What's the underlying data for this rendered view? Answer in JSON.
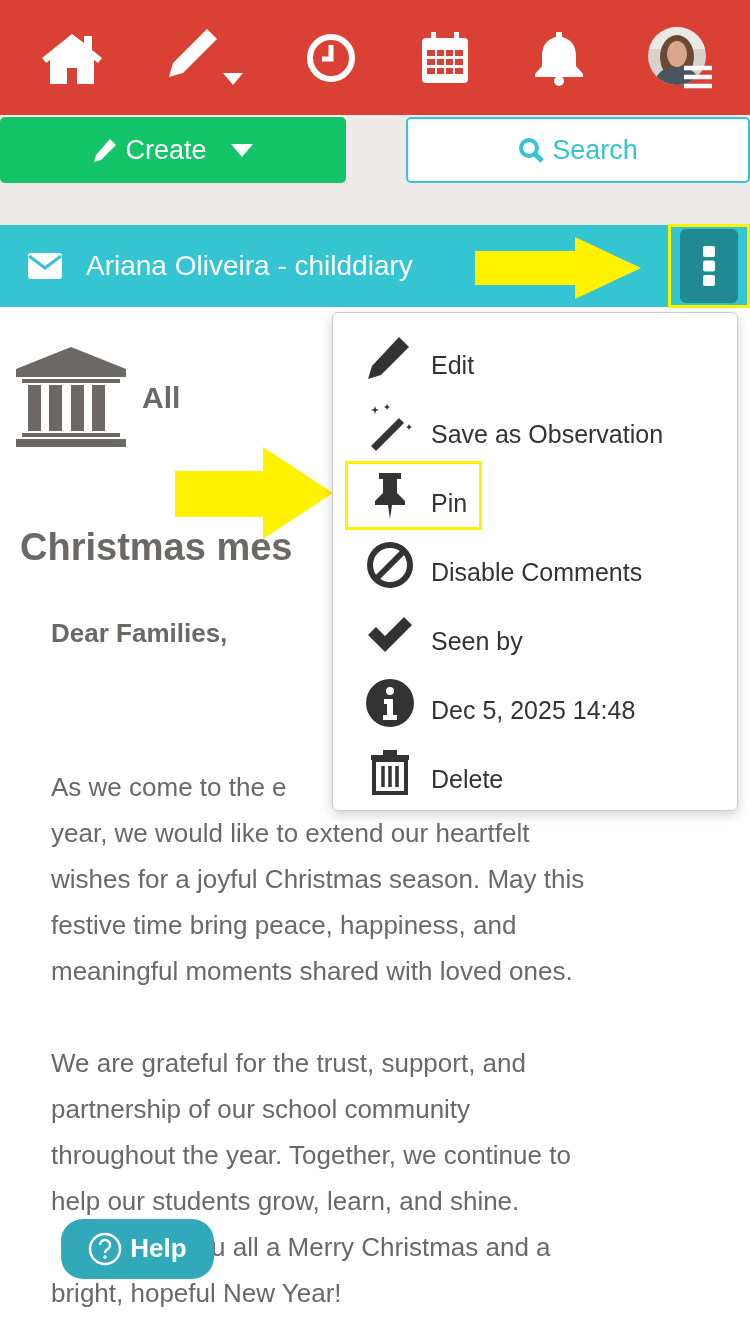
{
  "toolbar": {
    "create_button": "Create",
    "search_button": "Search"
  },
  "post_header": {
    "title": "Ariana Oliveira - childdiary",
    "menu_highlighted": true
  },
  "menu": {
    "items": [
      {
        "kind": "edit",
        "label": "Edit",
        "highlighted": false
      },
      {
        "kind": "observation",
        "label": "Save as Observation",
        "highlighted": false
      },
      {
        "kind": "pin",
        "label": "Pin",
        "highlighted": true
      },
      {
        "kind": "disable",
        "label": "Disable Comments",
        "highlighted": false
      },
      {
        "kind": "seen",
        "label": "Seen by",
        "highlighted": false
      },
      {
        "kind": "info",
        "label": "Dec 5, 2025 14:48",
        "highlighted": false
      },
      {
        "kind": "delete",
        "label": "Delete",
        "highlighted": false
      }
    ]
  },
  "audience": "All",
  "post": {
    "title": "Christmas mes",
    "greeting": "Dear Families,",
    "paragraphs": [
      {
        "lines": [
          {
            "parts": [
              "As we come to the e"
            ]
          },
          {
            "parts": [
              "year, we would like to extend our heartfelt"
            ]
          },
          {
            "parts": [
              "wishes for a joyful Christmas season. May this"
            ]
          },
          {
            "parts": [
              "festive time bring peace, happiness, and"
            ]
          },
          {
            "parts": [
              "meaningful moments shared with loved ones."
            ]
          }
        ]
      },
      {
        "lines": [
          {
            "parts": [
              "We are grateful for the trust, support, and"
            ]
          },
          {
            "parts": [
              "partnership of our school community"
            ]
          },
          {
            "parts": [
              "throughout the year. Together, we continue to"
            ]
          },
          {
            "parts": [
              "help our students grow, learn, and shine."
            ]
          },
          {
            "parts": [
              "u all a Merry Christmas and a"
            ],
            "help_button": "Help"
          },
          {
            "parts": [
              "bright, hopeful New Year!"
            ]
          }
        ]
      }
    ]
  }
}
